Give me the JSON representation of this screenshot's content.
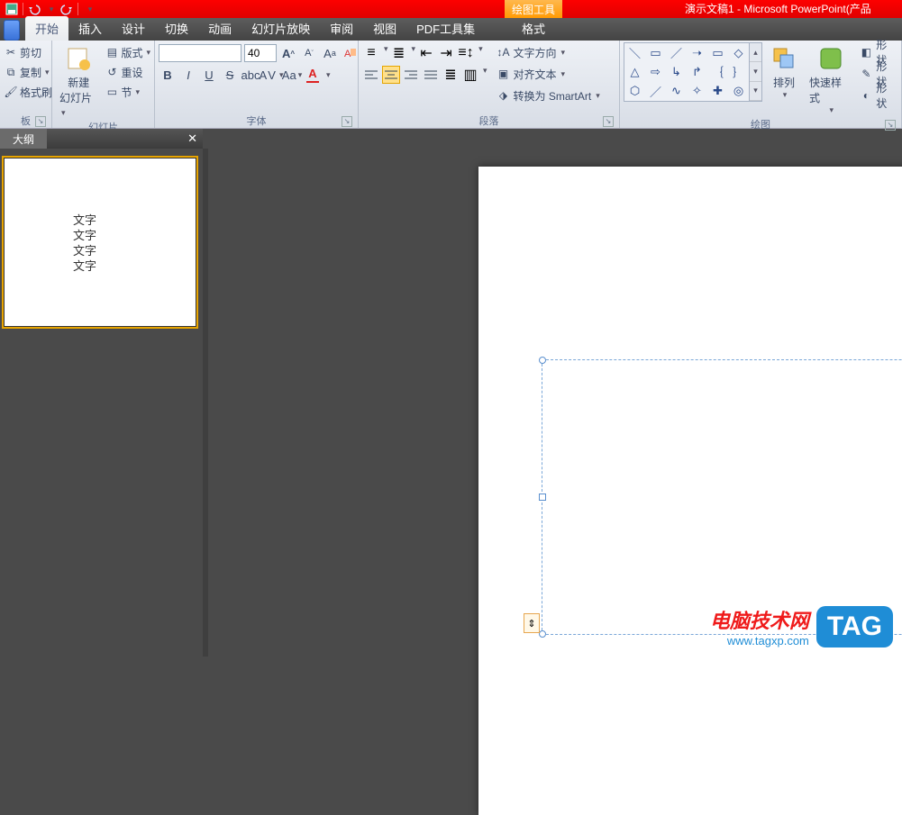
{
  "qat": {
    "drawtools": "绘图工具",
    "title": "演示文稿1 - Microsoft PowerPoint(产品"
  },
  "tabs": {
    "home": "开始",
    "insert": "插入",
    "design": "设计",
    "transition": "切换",
    "animation": "动画",
    "slideshow": "幻灯片放映",
    "review": "审阅",
    "view": "视图",
    "pdf": "PDF工具集",
    "format": "格式"
  },
  "ribbon": {
    "clipboard": {
      "cut": "剪切",
      "copy": "复制",
      "formatpainter": "格式刷",
      "label": "板"
    },
    "slides": {
      "new": "新建",
      "new2": "幻灯片",
      "layout": "版式",
      "reset": "重设",
      "section": "节",
      "label": "幻灯片"
    },
    "font": {
      "name": "",
      "size": "40",
      "label": "字体"
    },
    "paragraph": {
      "textdir": "文字方向",
      "align": "对齐文本",
      "smartart": "转换为 SmartArt",
      "label": "段落"
    },
    "drawing": {
      "arrange": "排列",
      "quickstyle": "快速样式",
      "shapefill": "形状",
      "shapeoutline": "形状",
      "shapeeffects": "形状",
      "label": "绘图"
    }
  },
  "panel": {
    "outline": "大纲",
    "close": "✕"
  },
  "thumb": {
    "l1": "文字",
    "l2": "文字",
    "l3": "文字",
    "l4": "文字"
  },
  "watermark": {
    "line1": "电脑技术网",
    "line2": "www.tagxp.com",
    "tag": "TAG"
  }
}
